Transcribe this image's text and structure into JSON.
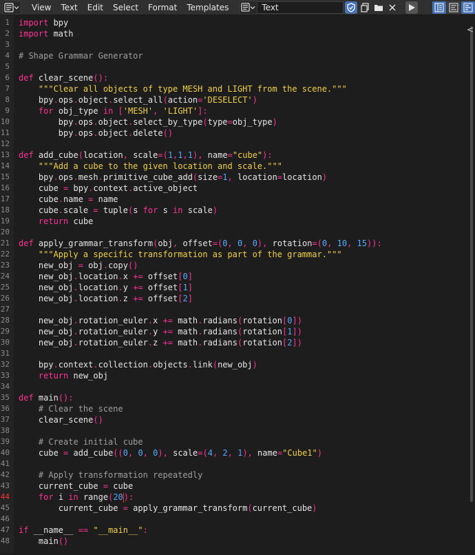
{
  "header": {
    "editor_type_icon": "text-editor-icon",
    "menus": [
      "View",
      "Text",
      "Edit",
      "Select",
      "Format",
      "Templates"
    ],
    "datablock_name": "Text",
    "icons": {
      "fake_user": "shield-check-icon",
      "new_text": "new-document-icon",
      "open_text": "folder-icon",
      "unlink": "close-icon",
      "run": "play-icon",
      "line_numbers": "line-numbers-icon",
      "word_wrap": "word-wrap-icon",
      "syntax": "syntax-highlight-icon"
    }
  },
  "editor": {
    "current_line": 44,
    "lines": [
      "import bpy",
      "import math",
      "",
      "# Shape Grammar Generator",
      "",
      "def clear_scene():",
      "    \"\"\"Clear all objects of type MESH and LIGHT from the scene.\"\"\"",
      "    bpy.ops.object.select_all(action='DESELECT')",
      "    for obj_type in ['MESH', 'LIGHT']:",
      "        bpy.ops.object.select_by_type(type=obj_type)",
      "        bpy.ops.object.delete()",
      "",
      "def add_cube(location, scale=(1,1,1), name=\"cube\"):",
      "    \"\"\"Add a cube to the given location and scale.\"\"\"",
      "    bpy.ops.mesh.primitive_cube_add(size=1, location=location)",
      "    cube = bpy.context.active_object",
      "    cube.name = name",
      "    cube.scale = tuple(s for s in scale)",
      "    return cube",
      "",
      "def apply_grammar_transform(obj, offset=(0, 0, 0), rotation=(0, 10, 15)):",
      "    \"\"\"Apply a specific transformation as part of the grammar.\"\"\"",
      "    new_obj = obj.copy()",
      "    new_obj.location.x += offset[0]",
      "    new_obj.location.y += offset[1]",
      "    new_obj.location.z += offset[2]",
      "",
      "    new_obj.rotation_euler.x += math.radians(rotation[0])",
      "    new_obj.rotation_euler.y += math.radians(rotation[1])",
      "    new_obj.rotation_euler.z += math.radians(rotation[2])",
      "",
      "    bpy.context.collection.objects.link(new_obj)",
      "    return new_obj",
      "",
      "def main():",
      "    # Clear the scene",
      "    clear_scene()",
      "",
      "    # Create initial cube",
      "    cube = add_cube((0, 0, 0), scale=(4, 2, 1), name=\"Cube1\")",
      "",
      "    # Apply transformation repeatedly",
      "    current_cube = cube",
      "    for i in range(20):",
      "        current_cube = apply_grammar_transform(current_cube)",
      "",
      "if __name__ == \"__main__\":",
      "    main()"
    ]
  },
  "colors": {
    "keyword": "#ff3395",
    "string": "#f1d04b",
    "number": "#55aaff",
    "comment": "#9f9f9f",
    "text": "#e6e6e6",
    "accent": "#4772b3"
  }
}
